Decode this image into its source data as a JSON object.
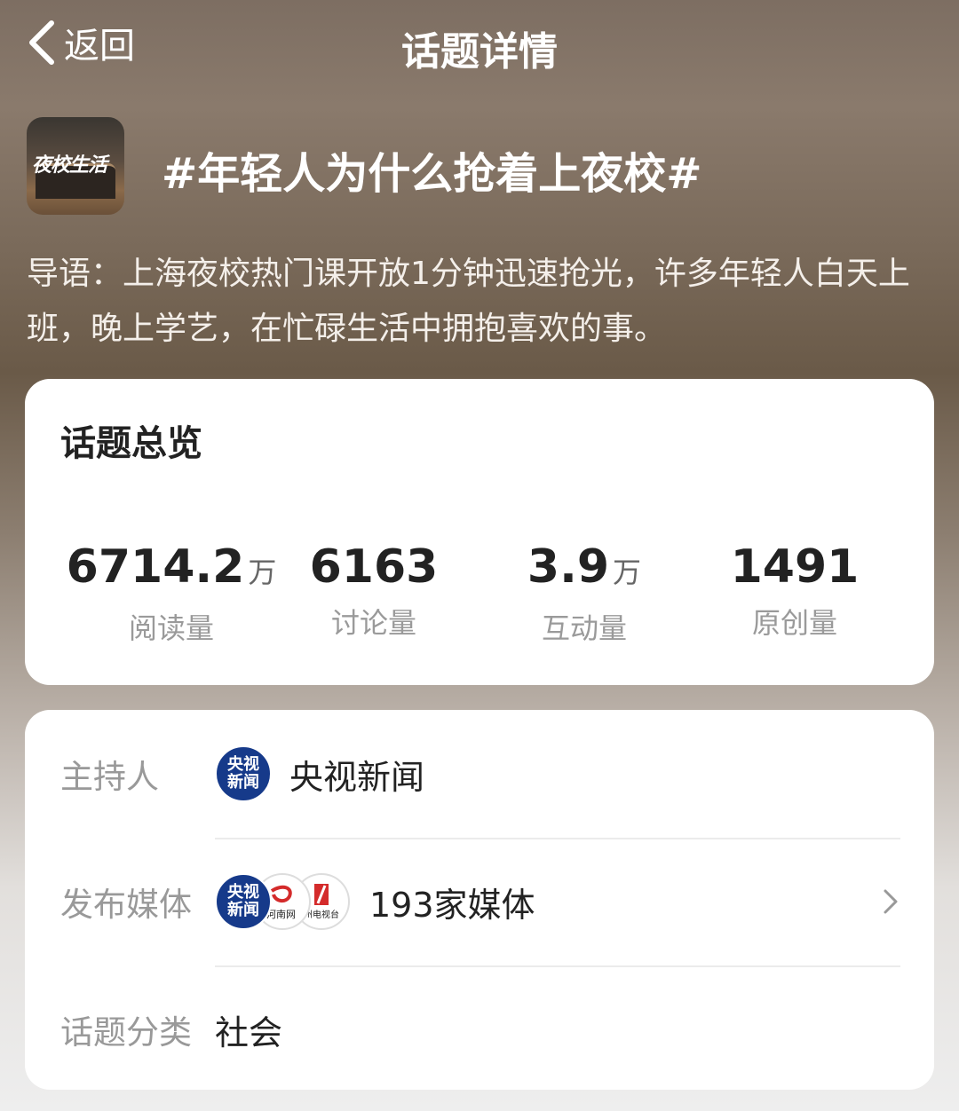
{
  "header": {
    "back_label": "返回",
    "title": "话题详情"
  },
  "topic": {
    "thumbnail_text": "夜校生活",
    "title": "#年轻人为什么抢着上夜校#",
    "intro": "导语：上海夜校热门课开放1分钟迅速抢光，许多年轻人白天上班，晚上学艺，在忙碌生活中拥抱喜欢的事。"
  },
  "overview": {
    "title": "话题总览",
    "stats": [
      {
        "value": "6714.2",
        "unit": "万",
        "label": "阅读量"
      },
      {
        "value": "6163",
        "unit": "",
        "label": "讨论量"
      },
      {
        "value": "3.9",
        "unit": "万",
        "label": "互动量"
      },
      {
        "value": "1491",
        "unit": "",
        "label": "原创量"
      }
    ]
  },
  "details": {
    "host": {
      "label": "主持人",
      "avatar_text": "央视新闻",
      "name": "央视新闻"
    },
    "media": {
      "label": "发布媒体",
      "avatar_texts": [
        "央视新闻",
        "河南网",
        "州电视台"
      ],
      "count": "193家媒体"
    },
    "category": {
      "label": "话题分类",
      "value": "社会"
    }
  },
  "icons": {
    "back": "chevron-left-icon",
    "more": "chevron-right-icon"
  }
}
